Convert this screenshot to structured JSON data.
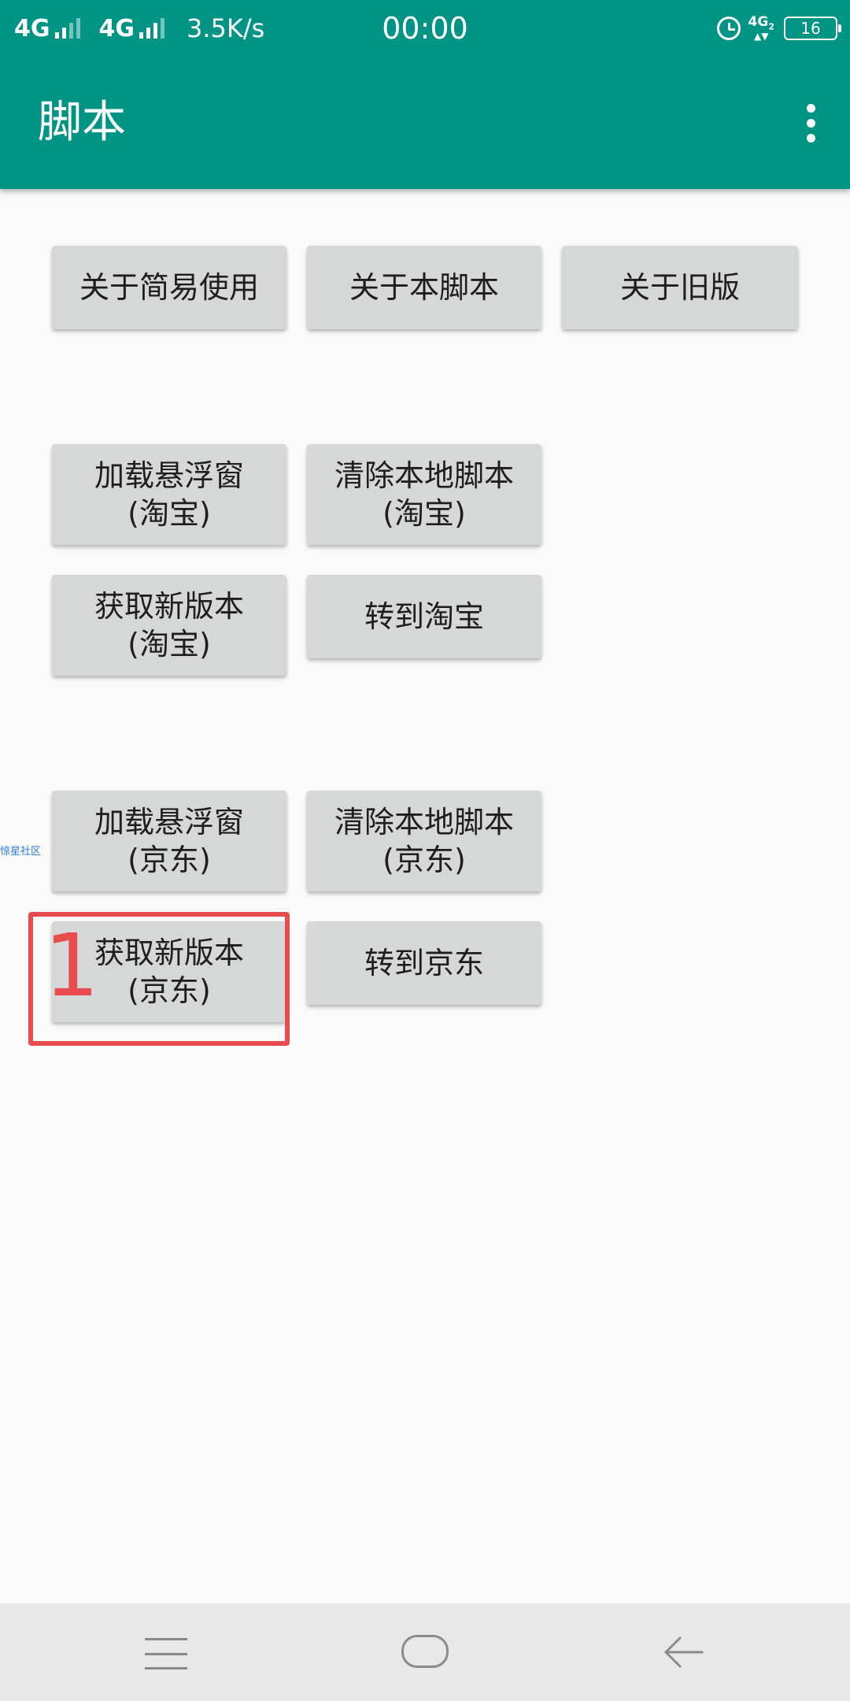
{
  "status_bar": {
    "network_1": "4G",
    "network_2": "4G",
    "speed": "3.5K/s",
    "time": "00:00",
    "sim2_network": "4G",
    "sim2_index": "2",
    "battery": "16"
  },
  "app_bar": {
    "title": "脚本"
  },
  "buttons": {
    "about_simple": "关于简易使用",
    "about_script": "关于本脚本",
    "about_old": "关于旧版",
    "taobao_load_float": "加载悬浮窗\n(淘宝)",
    "taobao_clear_local": "清除本地脚本\n(淘宝)",
    "taobao_get_new": "获取新版本\n(淘宝)",
    "taobao_goto": "转到淘宝",
    "jd_load_float": "加载悬浮窗\n(京东)",
    "jd_clear_local": "清除本地脚本\n(京东)",
    "jd_get_new": "获取新版本\n(京东)",
    "jd_goto": "转到京东"
  },
  "side_label": "惊星社区",
  "annotation": {
    "step_number": "1",
    "color": "#E84C4E"
  },
  "colors": {
    "primary": "#009484",
    "button_bg": "#D6D7D7",
    "background": "#FAFAFA"
  },
  "nav_icons": [
    "menu-icon",
    "home-icon",
    "back-icon"
  ]
}
